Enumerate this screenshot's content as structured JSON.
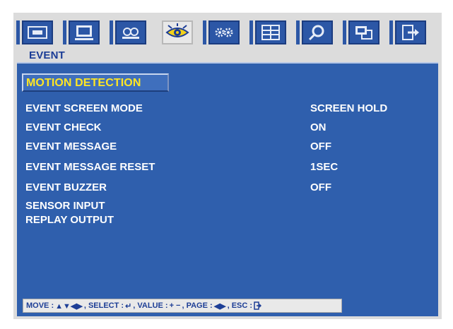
{
  "header": {
    "icons": [
      {
        "name": "picture-icon",
        "active": false
      },
      {
        "name": "screen-icon",
        "active": false
      },
      {
        "name": "audio-icon",
        "active": false
      },
      {
        "name": "event-eye-icon",
        "active": true
      },
      {
        "name": "settings-gears-icon",
        "active": false
      },
      {
        "name": "layout-icon",
        "active": false
      },
      {
        "name": "search-magnifier-icon",
        "active": false
      },
      {
        "name": "network-icon",
        "active": false
      },
      {
        "name": "exit-icon",
        "active": false
      }
    ]
  },
  "page": {
    "title": "EVENT"
  },
  "section": {
    "label": "MOTION DETECTION"
  },
  "menu": {
    "items": [
      {
        "label": "EVENT SCREEN MODE",
        "value": "SCREEN HOLD"
      },
      {
        "label": "EVENT CHECK",
        "value": "ON"
      },
      {
        "label": "EVENT MESSAGE",
        "value": "OFF"
      },
      {
        "label": "EVENT MESSAGE RESET",
        "value": "1SEC"
      },
      {
        "label": "EVENT BUZZER",
        "value": "OFF"
      },
      {
        "label": "SENSOR INPUT",
        "value": ""
      },
      {
        "label": "REPLAY OUTPUT",
        "value": ""
      }
    ]
  },
  "footer": {
    "move_label": "MOVE :",
    "select_label": ", SELECT :",
    "value_label": ", VALUE :",
    "page_label": ", PAGE :",
    "esc_label": ", ESC :"
  },
  "colors": {
    "panel": "#2f5fad",
    "section_text": "#ffe623",
    "title_text": "#1b3c96",
    "tab_blue": "#2c57a6"
  }
}
